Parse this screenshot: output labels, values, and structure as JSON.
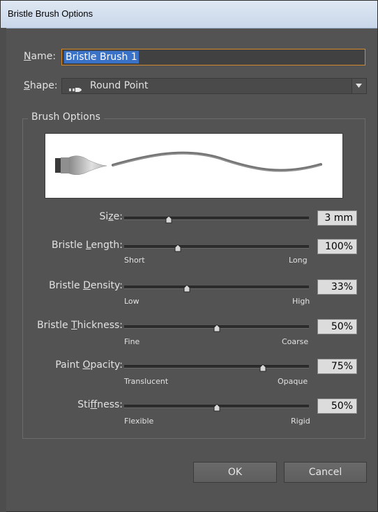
{
  "window": {
    "title": "Bristle Brush Options"
  },
  "name": {
    "label_prefix": "N",
    "label_rest": "ame:",
    "value": "Bristle Brush 1"
  },
  "shape": {
    "label_prefix": "S",
    "label_rest": "hape:",
    "value": "Round Point",
    "icon": "round-point-brush-icon"
  },
  "brush_options": {
    "title": "Brush Options"
  },
  "size": {
    "label_pre": "Si",
    "label_u": "z",
    "label_post": "e:",
    "value": "3 mm",
    "level": 0.24
  },
  "bristle_length": {
    "label_pre": "Bristle ",
    "label_u": "L",
    "label_post": "ength:",
    "value": "100%",
    "min_label": "Short",
    "max_label": "Long",
    "level": 0.29
  },
  "bristle_density": {
    "label_pre": "Bristle ",
    "label_u": "D",
    "label_post": "ensity:",
    "value": "33%",
    "min_label": "Low",
    "max_label": "High",
    "level": 0.34
  },
  "bristle_thickness": {
    "label_pre": "Bristle ",
    "label_u": "T",
    "label_post": "hickness:",
    "value": "50%",
    "min_label": "Fine",
    "max_label": "Coarse",
    "level": 0.5
  },
  "paint_opacity": {
    "label_pre": "Paint ",
    "label_u": "O",
    "label_post": "pacity:",
    "value": "75%",
    "min_label": "Translucent",
    "max_label": "Opaque",
    "level": 0.75
  },
  "stiffness": {
    "label_pre": "Sti",
    "label_u": "f",
    "label_post": "fness:",
    "value": "50%",
    "min_label": "Flexible",
    "max_label": "Rigid",
    "level": 0.5
  },
  "buttons": {
    "ok": "OK",
    "cancel": "Cancel"
  },
  "colors": {
    "background": "#535353",
    "selection": "#3a72c8",
    "focus_border": "#d38a2e"
  }
}
